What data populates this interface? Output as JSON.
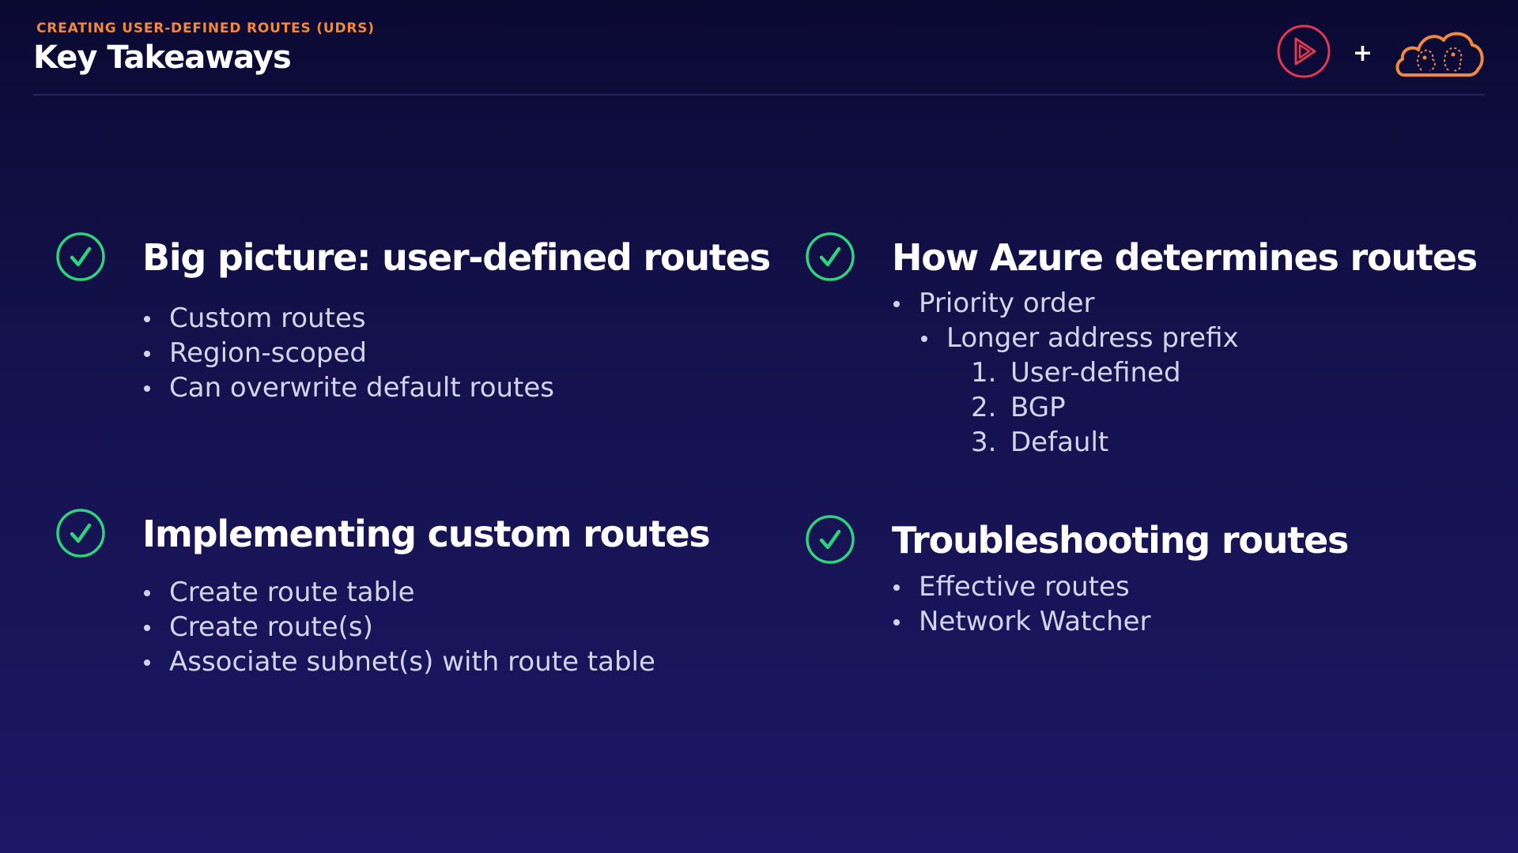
{
  "header": {
    "eyebrow": "CREATING USER-DEFINED ROUTES (UDRS)",
    "title": "Key Takeaways"
  },
  "logos": {
    "left_icon": "play-logo-icon",
    "plus": "+",
    "right_icon": "cloud-brain-icon"
  },
  "colors": {
    "accent_orange": "#f08a3a",
    "check_green": "#2fd47a",
    "play_logo_red": "#e0384f",
    "body_text": "#d4d4e8",
    "background": "#15124f"
  },
  "sections": [
    {
      "heading": "Big picture: user-defined routes",
      "bullets": [
        "Custom routes",
        "Region-scoped",
        "Can overwrite default routes"
      ]
    },
    {
      "heading": "How Azure determines routes",
      "bullets": [
        "Priority order"
      ],
      "sub_bullets": [
        "Longer address prefix"
      ],
      "ordered": [
        {
          "num": "1.",
          "text": "User-defined"
        },
        {
          "num": "2.",
          "text": "BGP"
        },
        {
          "num": "3.",
          "text": "Default"
        }
      ]
    },
    {
      "heading": "Implementing custom routes",
      "bullets": [
        "Create route table",
        "Create route(s)",
        "Associate subnet(s) with route table"
      ]
    },
    {
      "heading": "Troubleshooting routes",
      "bullets": [
        "Effective routes",
        "Network Watcher"
      ]
    }
  ]
}
